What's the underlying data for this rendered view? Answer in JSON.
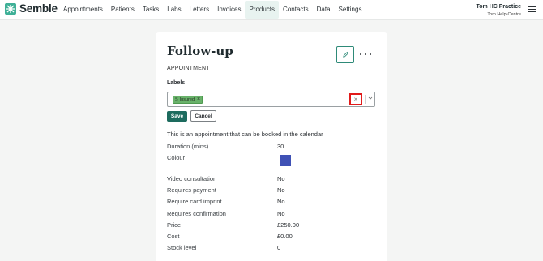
{
  "app": {
    "brand": "Semble",
    "nav": [
      "Appointments",
      "Patients",
      "Tasks",
      "Labs",
      "Letters",
      "Invoices",
      "Products",
      "Contacts",
      "Data",
      "Settings"
    ],
    "active_nav": "Products",
    "practice_name": "Tom HC Practice",
    "practice_user": "Tom Help-Centre",
    "menu_icon": "hamburger-menu-icon"
  },
  "product": {
    "title": "Follow-up",
    "type": "APPOINTMENT",
    "labels_heading": "Labels",
    "label_chip": {
      "dot": "S",
      "text": "Insured",
      "remove": "×",
      "color": "#69b26a"
    },
    "clear_symbol": "×",
    "save_label": "Save",
    "cancel_label": "Cancel",
    "description": "This is an appointment that can be booked in the calendar",
    "colour": "#3f51b5",
    "fields": [
      {
        "label": "Duration (mins)",
        "value": "30"
      },
      {
        "label": "Colour",
        "value": ""
      },
      {
        "label": "Video consultation",
        "value": "No"
      },
      {
        "label": "Requires payment",
        "value": "No"
      },
      {
        "label": "Require card imprint",
        "value": "No"
      },
      {
        "label": "Requires confirmation",
        "value": "No"
      },
      {
        "label": "Price",
        "value": "£250.00"
      },
      {
        "label": "Cost",
        "value": "£0.00"
      },
      {
        "label": "Stock level",
        "value": "0"
      }
    ]
  },
  "colors": {
    "accent": "#1d6b5e",
    "brand": "#3fb097",
    "highlight": "#e11b1b"
  }
}
